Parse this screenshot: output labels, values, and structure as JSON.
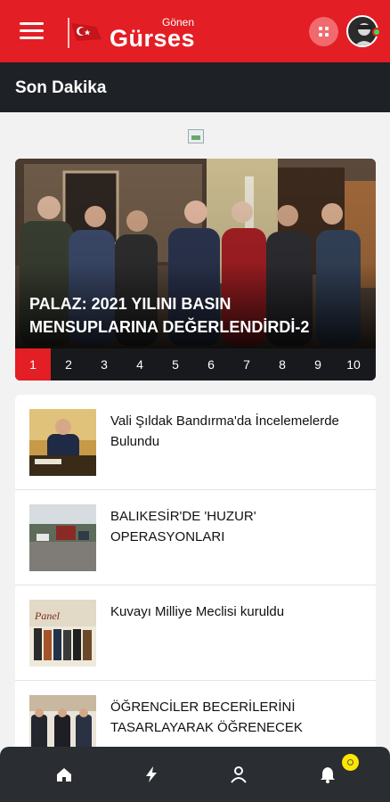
{
  "header": {
    "logo_small": "Gönen",
    "logo_big": "Gürses",
    "brand_color": "#e31e24"
  },
  "section": {
    "title": "Son Dakika"
  },
  "slider": {
    "headline": "PALAZ: 2021 YILINI BASIN MENSUPLARINA DEĞERLENDİRDİ-2",
    "pages": [
      "1",
      "2",
      "3",
      "4",
      "5",
      "6",
      "7",
      "8",
      "9",
      "10"
    ],
    "active_page": "1"
  },
  "news": [
    {
      "title": "Vali Şıldak Bandırma'da İncelemelerde Bulundu",
      "thumb": "official-desk-photo"
    },
    {
      "title": "BALIKESİR'DE 'HUZUR' OPERASYONLARI",
      "thumb": "road-vehicles-photo"
    },
    {
      "title": "Kuvayı Milliye Meclisi kuruldu",
      "thumb": "panel-group-photo"
    },
    {
      "title": "ÖĞRENCİLER BECERİLERİNİ TASARLAYARAK ÖĞRENECEK",
      "thumb": "ceremony-group-photo"
    }
  ],
  "bottom_nav": {
    "items": [
      "home-icon",
      "lightning-icon",
      "user-icon",
      "bell-icon"
    ]
  },
  "colors": {
    "accent": "#e31e24",
    "dark": "#1e2126",
    "badge": "#ffe600"
  }
}
